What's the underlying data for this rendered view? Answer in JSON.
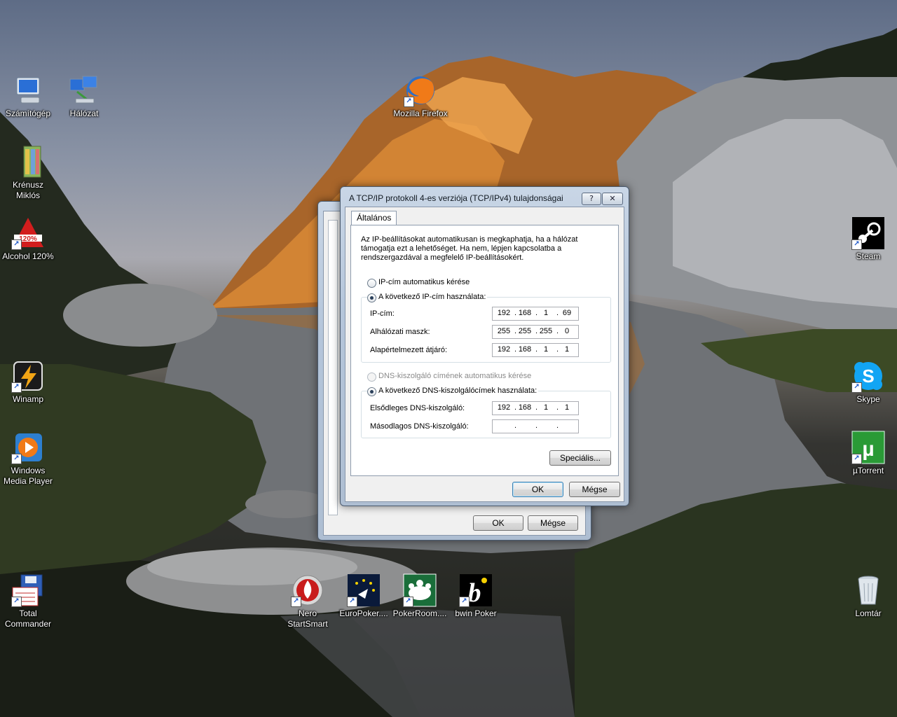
{
  "desktop": {
    "icons_left": [
      {
        "label": "Számítógép"
      },
      {
        "label": "Hálózat"
      },
      {
        "label": "Krénusz Miklós"
      },
      {
        "label": "Alcohol 120%"
      },
      {
        "label": "Winamp"
      },
      {
        "label": "Windows Media Player"
      },
      {
        "label": "Total Commander"
      }
    ],
    "icons_mid": [
      {
        "label": "Mozilla Firefox"
      },
      {
        "label": "Nero StartSmart"
      },
      {
        "label": "EuroPoker...."
      },
      {
        "label": "PokerRoom...."
      },
      {
        "label": "bwin Poker"
      }
    ],
    "icons_right": [
      {
        "label": "Steam"
      },
      {
        "label": "Skype"
      },
      {
        "label": "µTorrent"
      },
      {
        "label": "Lomtár"
      }
    ],
    "alcohol_badge": "120%"
  },
  "back_dialog": {
    "ok_label": "OK",
    "cancel_label": "Mégse"
  },
  "dialog": {
    "title": "A TCP/IP protokoll 4-es verziója (TCP/IPv4) tulajdonságai",
    "help_glyph": "?",
    "close_glyph": "✕",
    "tab_general": "Általános",
    "description": [
      "Az IP-beállításokat automatikusan is megkaphatja, ha a hálózat",
      "támogatja ezt a lehetőséget. Ha nem, lépjen kapcsolatba a",
      "rendszergazdával a megfelelő IP-beállításokért."
    ],
    "radio_ip_auto": "IP-cím automatikus kérése",
    "radio_ip_manual": "A következő IP-cím használata:",
    "ip_label": "IP-cím:",
    "ip_value": [
      "192",
      "168",
      "1",
      "69"
    ],
    "mask_label": "Alhálózati maszk:",
    "mask_value": [
      "255",
      "255",
      "255",
      "0"
    ],
    "gateway_label": "Alapértelmezett átjáró:",
    "gateway_value": [
      "192",
      "168",
      "1",
      "1"
    ],
    "radio_dns_auto": "DNS-kiszolgáló címének automatikus kérése",
    "radio_dns_manual": "A következő DNS-kiszolgálócímek használata:",
    "dns1_label": "Elsődleges DNS-kiszolgáló:",
    "dns1_value": [
      "192",
      "168",
      "1",
      "1"
    ],
    "dns2_label": "Másodlagos DNS-kiszolgáló:",
    "dns2_value": [
      "",
      "",
      "",
      ""
    ],
    "advanced_label": "Speciális...",
    "ok_label": "OK",
    "cancel_label": "Mégse",
    "selected": {
      "ip": "manual",
      "dns": "manual"
    }
  }
}
